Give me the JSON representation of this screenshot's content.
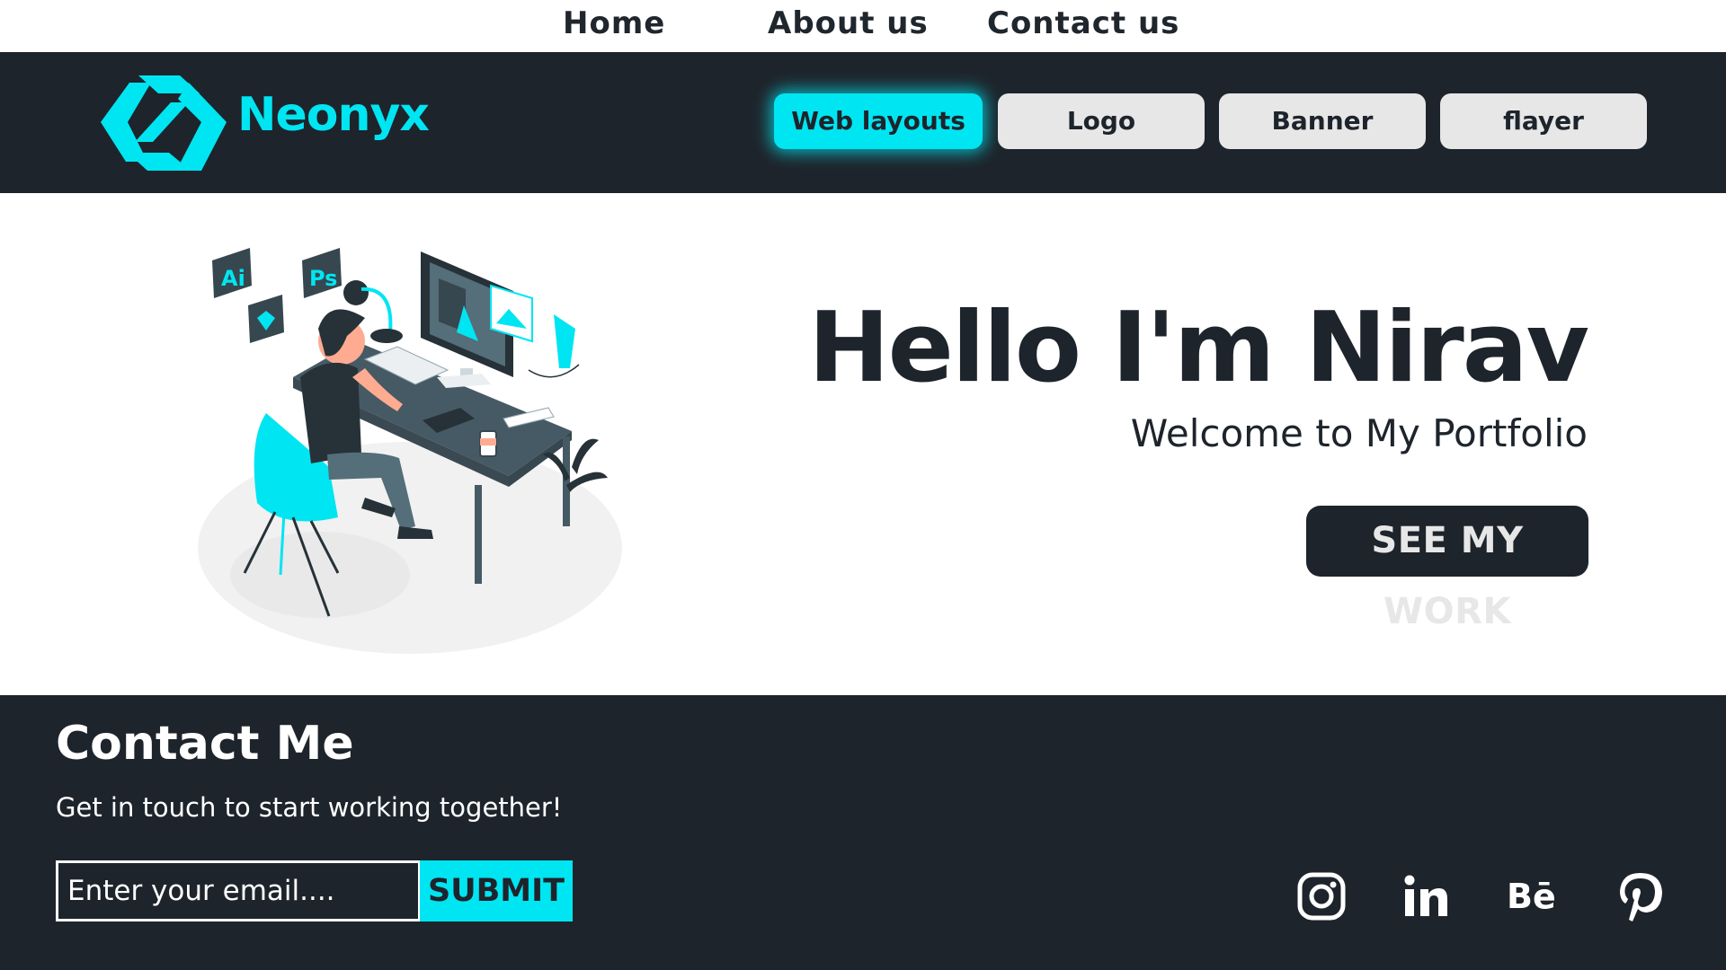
{
  "topnav": {
    "home": "Home",
    "about": "About us",
    "contact": "Contact us"
  },
  "brand": {
    "name": "Neonyx",
    "accent": "#00e5f2",
    "dark": "#1e242b"
  },
  "categories": [
    {
      "label": "Web layouts",
      "active": true
    },
    {
      "label": "Logo",
      "active": false
    },
    {
      "label": "Banner",
      "active": false
    },
    {
      "label": "flayer",
      "active": false
    }
  ],
  "hero": {
    "title": "Hello I'm Nirav",
    "subtitle": "Welcome to My Portfolio",
    "cta": "SEE MY WORK",
    "illustration_badges": [
      "Ai",
      "Ps"
    ]
  },
  "footer": {
    "title": "Contact Me",
    "subtitle": "Get in touch to start working together!",
    "email_placeholder": "Enter your email....",
    "submit_label": "SUBMIT",
    "social": [
      "instagram-icon",
      "linkedin-icon",
      "behance-icon",
      "pinterest-icon"
    ],
    "behance_glyph": "Bē"
  }
}
